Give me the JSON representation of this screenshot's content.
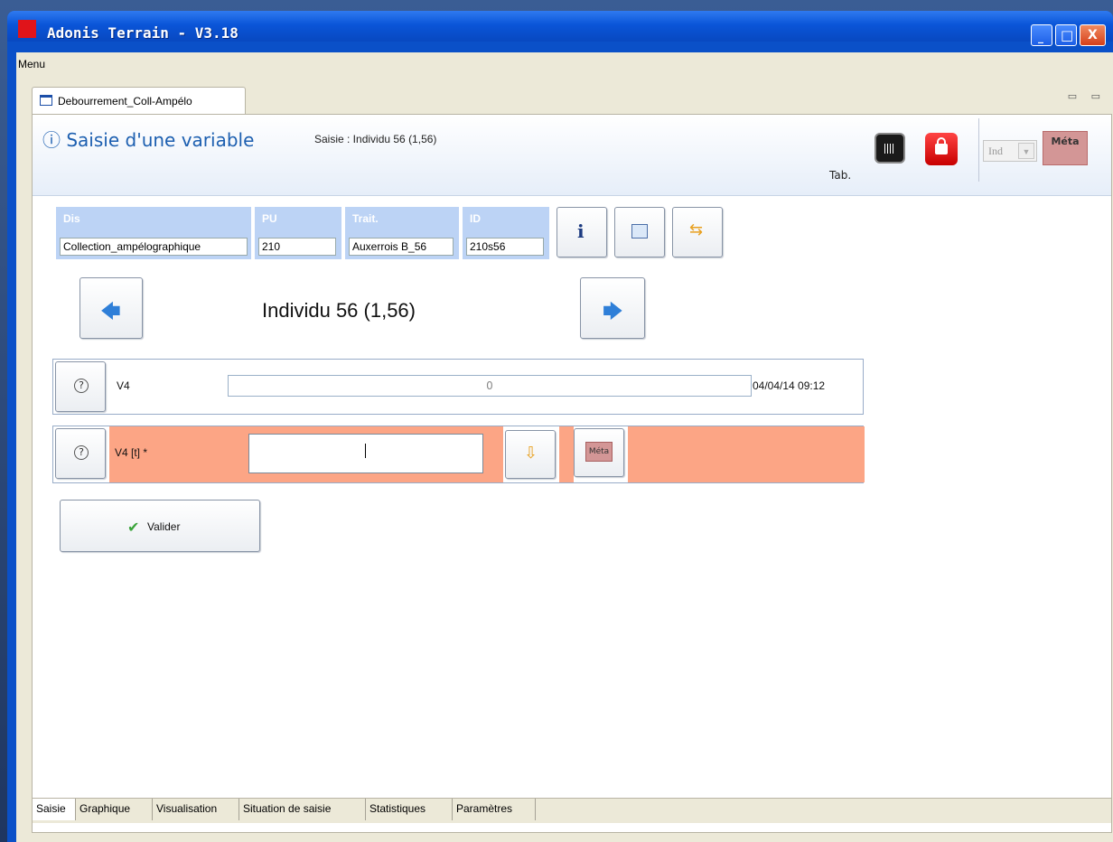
{
  "window": {
    "title": "Adonis Terrain - V3.18",
    "controls": {
      "minimize": "_",
      "maximize": "□",
      "close": "X"
    }
  },
  "menu": {
    "label": "Menu"
  },
  "editor_tab": {
    "label": "Debourrement_Coll-Ampélo",
    "view_controls": "▭ ▭"
  },
  "header": {
    "title": "ⓘ Saisie d'une variable",
    "subtitle": "Saisie : Individu 56 (1,56)",
    "tab_label": "Tab.",
    "select_value": "Ind",
    "meta_label": "Méta"
  },
  "info": {
    "dis": {
      "caption": "Dis",
      "value": "Collection_ampélographique"
    },
    "pu": {
      "caption": "PU",
      "value": "210"
    },
    "trait": {
      "caption": "Trait.",
      "value": "Auxerrois B_56"
    },
    "id": {
      "caption": "ID",
      "value": "210s56"
    }
  },
  "nav": {
    "label": "Individu  56 (1,56)"
  },
  "variable_row": {
    "name": "V4",
    "value": "0",
    "datetime": "04/04/14 09:12"
  },
  "input_row": {
    "name": "V4 [t] *",
    "value": "",
    "meta_label": "Méta"
  },
  "valider": {
    "label": "Valider"
  },
  "bottom_tabs": [
    "Saisie",
    "Graphique",
    "Visualisation",
    "Situation de saisie",
    "Statistiques",
    "Paramètres"
  ],
  "icons": {
    "info": "info-icon",
    "grid": "grid-icon",
    "swap": "swap-icon",
    "prev": "arrow-left-icon",
    "next": "arrow-right-icon",
    "help": "help-icon",
    "down": "arrow-down-icon",
    "check": "check-icon",
    "barcode": "barcode-icon",
    "lock": "lock-icon"
  },
  "colors": {
    "accent": "#1c5fb0",
    "row_highlight": "#fca585",
    "info_cell": "#bcd3f5",
    "meta": "#d39696"
  }
}
